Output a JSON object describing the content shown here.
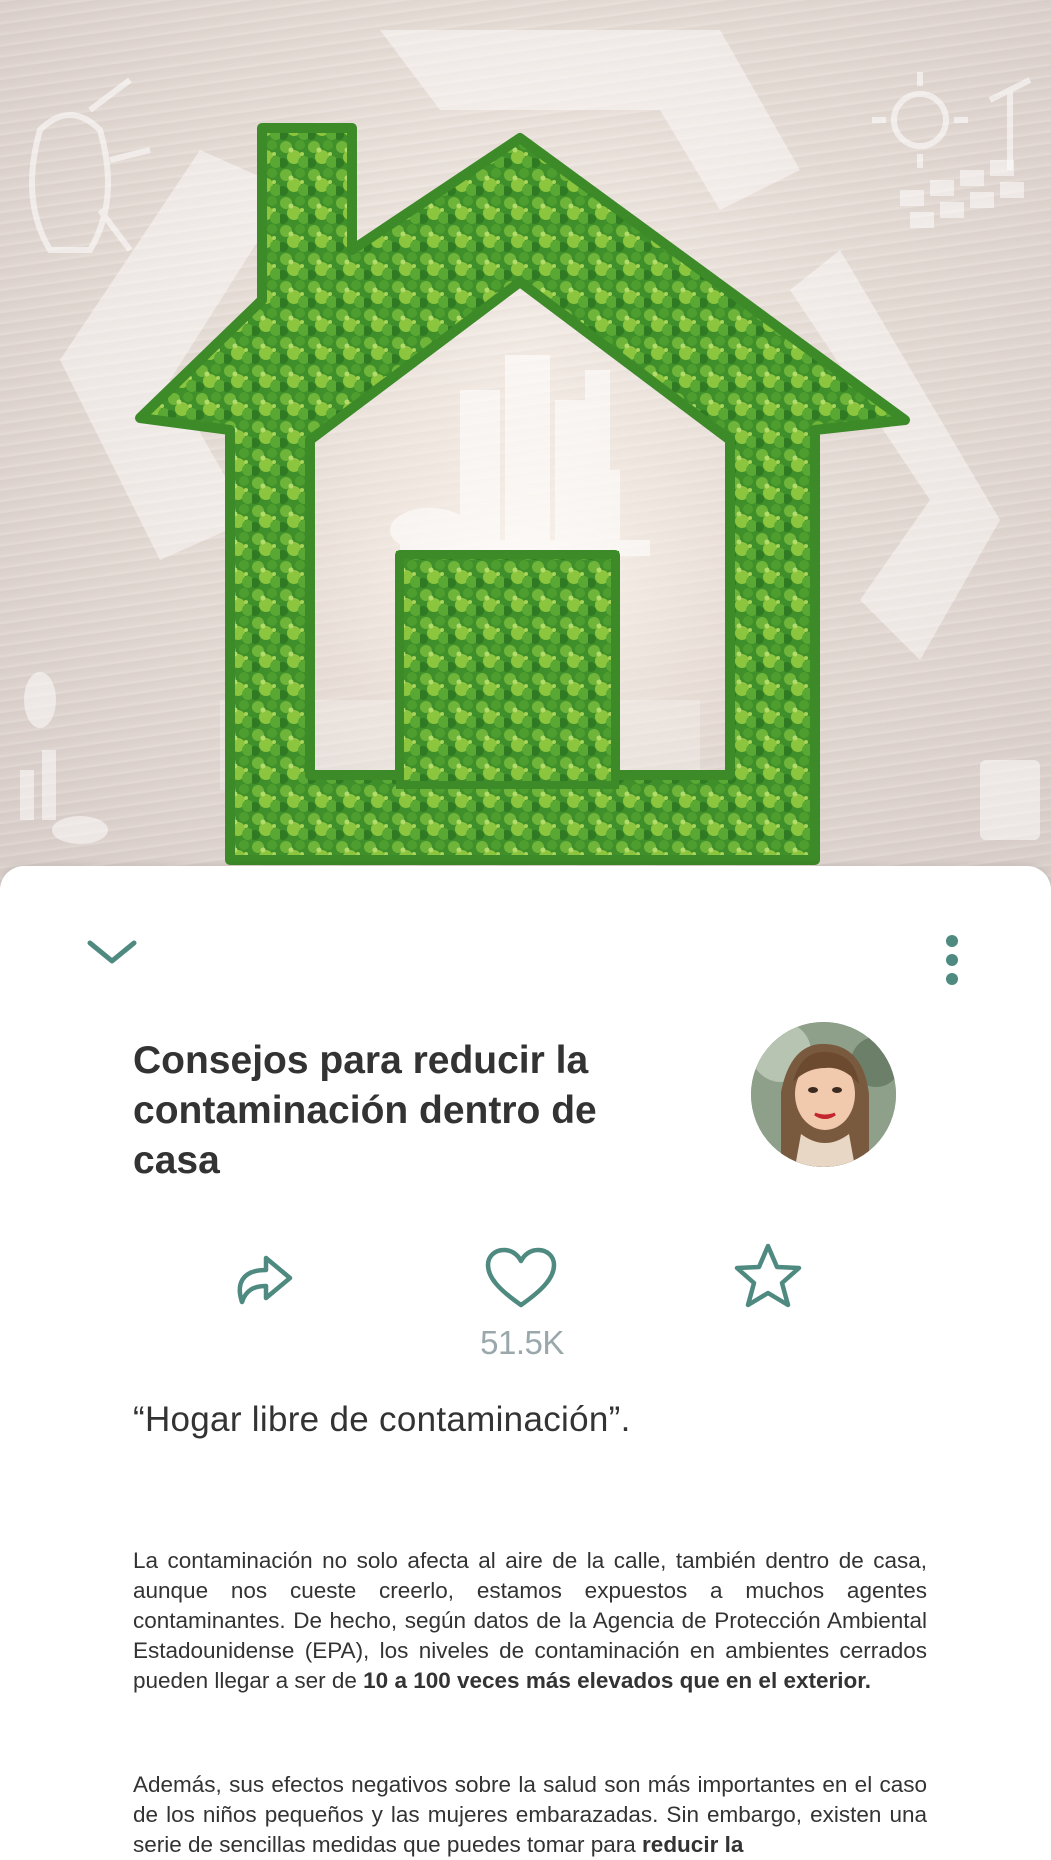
{
  "hero": {
    "image": "green-leaf-house-recycling-background"
  },
  "sheet": {
    "collapse_icon": "chevron-down-icon",
    "more_icon": "more-vertical-icon"
  },
  "article": {
    "title": "Consejos para reducir la contaminación dentro de casa",
    "author_avatar": "author-avatar-photo",
    "actions": {
      "share_icon": "share-icon",
      "like_icon": "heart-icon",
      "like_count": "51.5K",
      "favorite_icon": "star-icon"
    },
    "quote": "“Hogar libre de contaminación”.",
    "paragraph1": {
      "text": "La contaminación no solo afecta al aire de la calle, también dentro de casa, aunque nos cueste creerlo, estamos expuestos a muchos agentes contaminantes. De hecho, según datos de la Agencia de Protección Ambiental Estadounidense (EPA), los niveles de contaminación en ambientes cerrados pueden llegar a ser de ",
      "bold": "10 a 100 veces más elevados que en el exterior."
    },
    "paragraph2": {
      "text": "Además, sus efectos negativos sobre la salud son más importantes en el caso de los niños pequeños y las mujeres embarazadas. Sin embargo, existen una serie de sencillas medidas que puedes tomar para ",
      "bold": "reducir la"
    }
  },
  "colors": {
    "accent": "#4e8a80",
    "title": "#333333",
    "count": "#9aa8ab",
    "leaf_dark": "#2f7a22",
    "leaf_light": "#8cc63f"
  }
}
